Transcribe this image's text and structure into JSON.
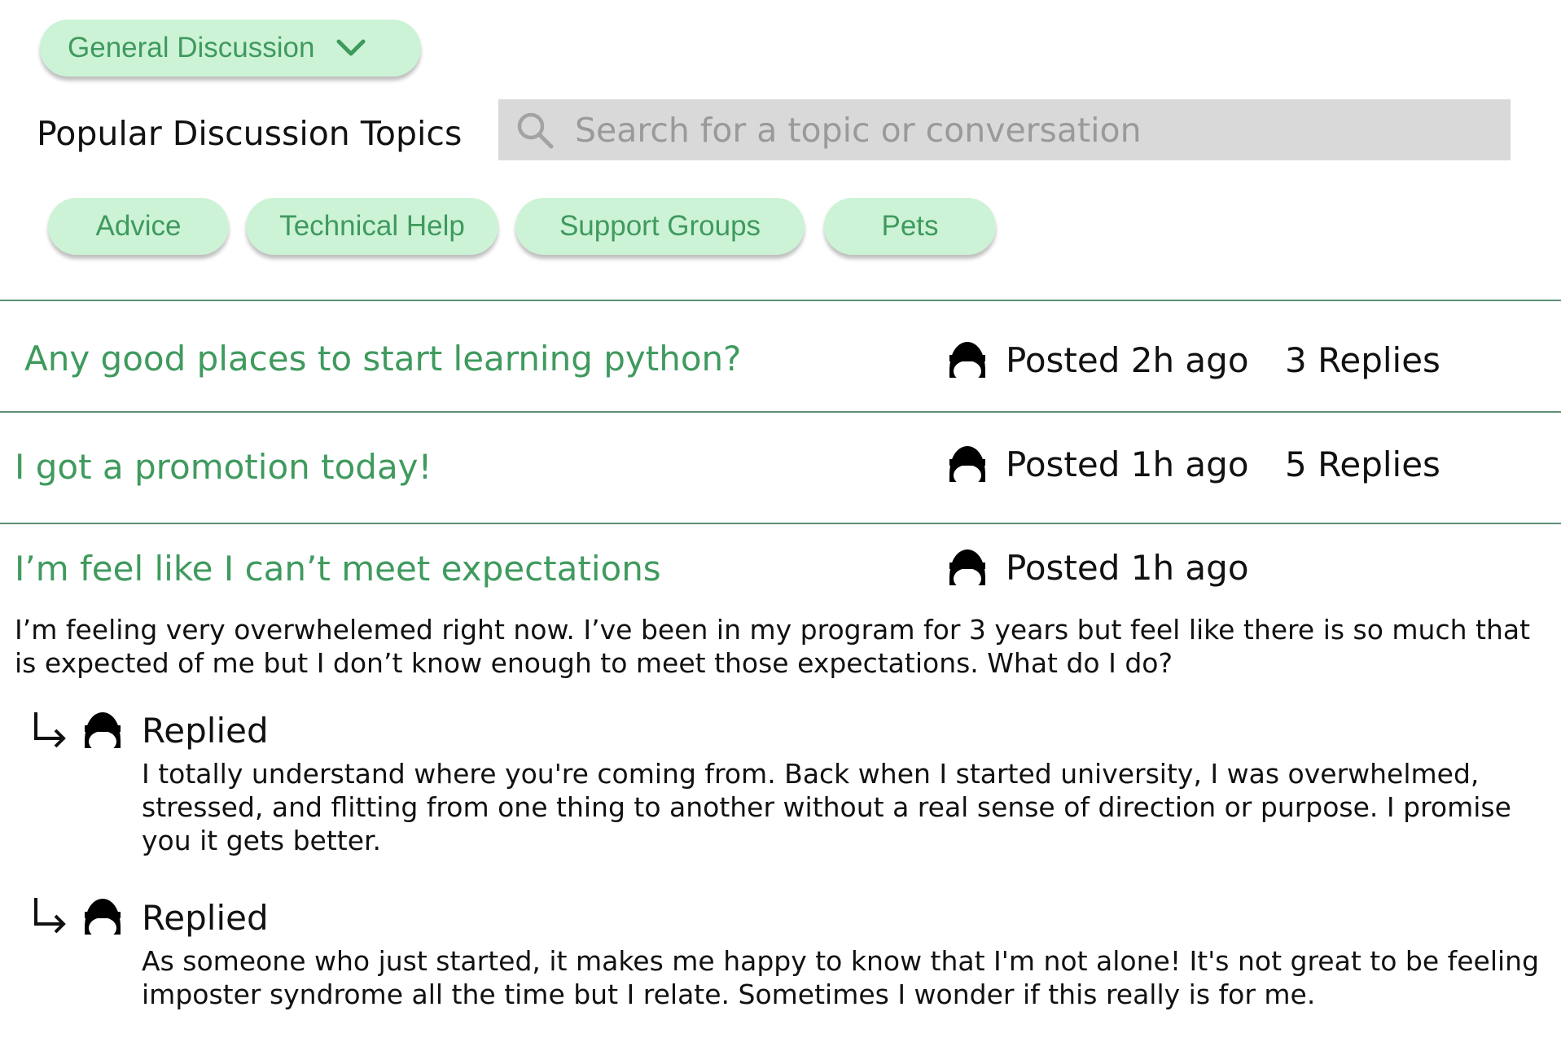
{
  "category_dropdown": {
    "label": "General Discussion"
  },
  "header": {
    "title": "Popular Discussion Topics"
  },
  "search": {
    "placeholder": "Search for a topic or conversation"
  },
  "topic_chips": [
    "Advice",
    "Technical Help",
    "Support Groups",
    "Pets"
  ],
  "threads": [
    {
      "title": "Any good places to start learning python?",
      "posted": "Posted 2h ago",
      "replies": "3 Replies"
    },
    {
      "title": "I got a promotion today!",
      "posted": "Posted 1h ago",
      "replies": "5 Replies"
    },
    {
      "title": "I’m feel like I can’t meet expectations",
      "posted": "Posted 1h ago",
      "body": "I’m feeling very overwhelemed right now. I’ve been in my program for 3 years but feel like there is so much that is expected of me but I don’t know enough to meet those expectations. What do I do?",
      "replies_list": [
        {
          "label": "Replied",
          "text": "I totally understand where you're coming from. Back when I started university, I was overwhelmed, stressed, and flitting from one thing to another without a real sense of direction or purpose. I promise you it gets better."
        },
        {
          "label": "Replied",
          "text": "As someone who just started, it makes me happy to know that I'm not alone! It's not great to be feeling imposter syndrome all the time but I relate. Sometimes I wonder if this really is for me."
        }
      ]
    }
  ],
  "colors": {
    "accent": "#3f9a5e",
    "chip_bg": "#cdf3d6",
    "search_bg": "#d9d9d9",
    "divider": "#5f8f75"
  },
  "icons": {
    "dropdown": "chevron-down-icon",
    "search": "search-icon",
    "user": "user-avatar-icon",
    "reply": "reply-arrow-icon"
  }
}
